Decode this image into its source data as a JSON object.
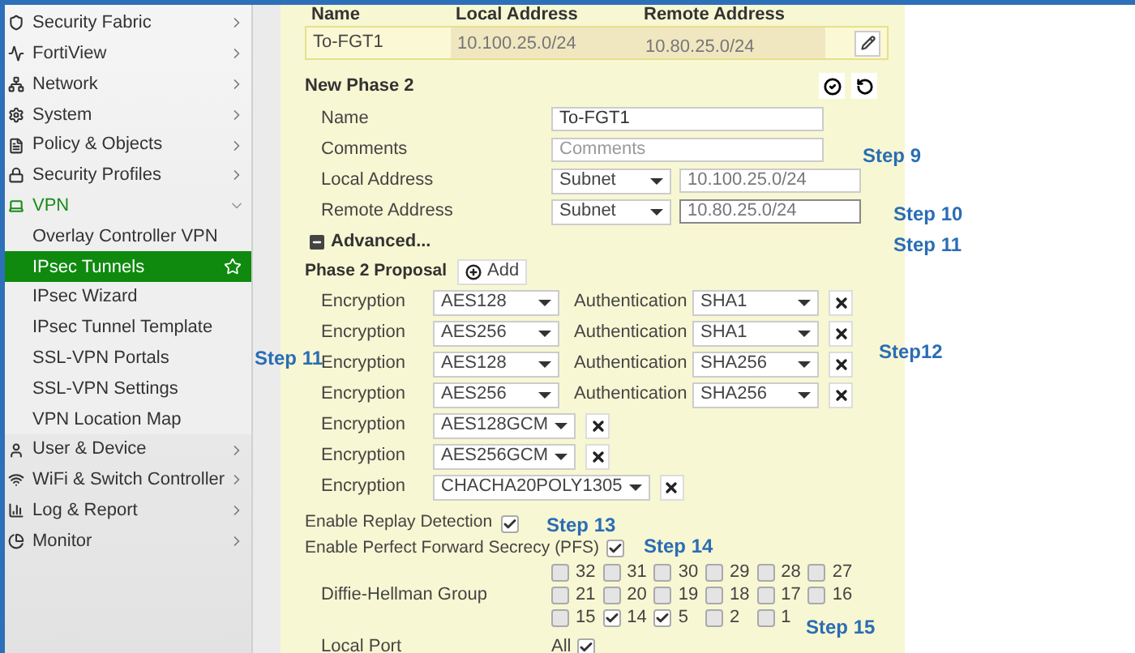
{
  "sidebar": {
    "items": [
      {
        "label": "Security Fabric",
        "expanded": false
      },
      {
        "label": "FortiView",
        "expanded": false
      },
      {
        "label": "Network",
        "expanded": false
      },
      {
        "label": "System",
        "expanded": false
      },
      {
        "label": "Policy & Objects",
        "expanded": false
      },
      {
        "label": "Security Profiles",
        "expanded": false
      },
      {
        "label": "VPN",
        "expanded": true,
        "children": [
          {
            "label": "Overlay Controller VPN",
            "selected": false
          },
          {
            "label": "IPsec Tunnels",
            "selected": true
          },
          {
            "label": "IPsec Wizard",
            "selected": false
          },
          {
            "label": "IPsec Tunnel Template",
            "selected": false
          },
          {
            "label": "SSL-VPN Portals",
            "selected": false
          },
          {
            "label": "SSL-VPN Settings",
            "selected": false
          },
          {
            "label": "VPN Location Map",
            "selected": false
          }
        ]
      },
      {
        "label": "User & Device",
        "expanded": false
      },
      {
        "label": "WiFi & Switch Controller",
        "expanded": false
      },
      {
        "label": "Log & Report",
        "expanded": false
      },
      {
        "label": "Monitor",
        "expanded": false
      }
    ]
  },
  "phase2_table": {
    "columns": [
      "Name",
      "Local Address",
      "Remote Address"
    ],
    "rows": [
      [
        "To-FGT1",
        "10.100.25.0/24",
        "10.80.25.0/24"
      ]
    ]
  },
  "form": {
    "title": "New Phase 2",
    "name": {
      "label": "Name",
      "value": "To-FGT1"
    },
    "comments": {
      "label": "Comments",
      "placeholder": "Comments"
    },
    "local_address": {
      "label": "Local Address",
      "type": "Subnet",
      "value": "10.100.25.0/24"
    },
    "remote_address": {
      "label": "Remote Address",
      "type": "Subnet",
      "value": "10.80.25.0/24"
    },
    "advanced": {
      "label": "Advanced...",
      "expanded": true
    },
    "proposal_label": "Phase 2 Proposal",
    "add_button": "Add",
    "proposals": [
      {
        "encryption_label": "Encryption",
        "encryption": "AES128",
        "authentication_label": "Authentication",
        "authentication": "SHA1"
      },
      {
        "encryption_label": "Encryption",
        "encryption": "AES256",
        "authentication_label": "Authentication",
        "authentication": "SHA1"
      },
      {
        "encryption_label": "Encryption",
        "encryption": "AES128",
        "authentication_label": "Authentication",
        "authentication": "SHA256"
      },
      {
        "encryption_label": "Encryption",
        "encryption": "AES256",
        "authentication_label": "Authentication",
        "authentication": "SHA256"
      },
      {
        "encryption_label": "Encryption",
        "encryption": "AES128GCM"
      },
      {
        "encryption_label": "Encryption",
        "encryption": "AES256GCM"
      },
      {
        "encryption_label": "Encryption",
        "encryption": "CHACHA20POLY1305"
      }
    ],
    "replay_detection": {
      "label": "Enable Replay Detection",
      "checked": true
    },
    "pfs": {
      "label": "Enable Perfect Forward Secrecy (PFS)",
      "checked": true
    },
    "dh_group": {
      "label": "Diffie-Hellman Group",
      "options": [
        {
          "label": "32",
          "checked": false
        },
        {
          "label": "31",
          "checked": false
        },
        {
          "label": "30",
          "checked": false
        },
        {
          "label": "29",
          "checked": false
        },
        {
          "label": "28",
          "checked": false
        },
        {
          "label": "27",
          "checked": false
        },
        {
          "label": "21",
          "checked": false
        },
        {
          "label": "20",
          "checked": false
        },
        {
          "label": "19",
          "checked": false
        },
        {
          "label": "18",
          "checked": false
        },
        {
          "label": "17",
          "checked": false
        },
        {
          "label": "16",
          "checked": false
        },
        {
          "label": "15",
          "checked": false
        },
        {
          "label": "14",
          "checked": true
        },
        {
          "label": "5",
          "checked": true
        },
        {
          "label": "2",
          "checked": false
        },
        {
          "label": "1",
          "checked": false
        }
      ]
    },
    "local_port": {
      "label": "Local Port",
      "value": "All",
      "checked": true
    }
  },
  "annotations": [
    "Step 9",
    "Step 10",
    "Step 11",
    "Step 11",
    "Step12",
    "Step 13",
    "Step 14",
    "Step 15"
  ]
}
